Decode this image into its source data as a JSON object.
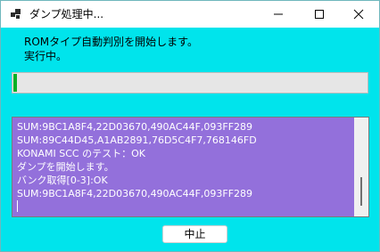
{
  "window": {
    "title": "ダンプ処理中...",
    "bg_color": "#00e4ec"
  },
  "message": {
    "line1": "ROMタイプ自動判別を開始します。",
    "line2": "実行中。"
  },
  "progress": {
    "value_fraction": 0.01,
    "color": "#06b025"
  },
  "log": {
    "bg_color": "#9370db",
    "lines": [
      "SUM:9BC1A8F4,22D03670,490AC44F,093FF289",
      "SUM:89C44D45,A1AB2891,76D5C4F7,768146FD",
      "KONAMI SCC のテスト：OK",
      "ダンプを開始します。",
      "バンク取得[0-3]:OK",
      "SUM:9BC1A8F4,22D03670,490AC44F,093FF289"
    ]
  },
  "buttons": {
    "abort_label": "中止"
  }
}
